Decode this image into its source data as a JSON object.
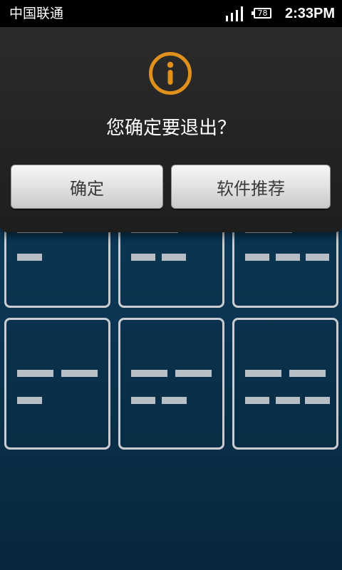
{
  "status_bar": {
    "carrier": "中国联通",
    "battery_level": "78",
    "time": "2:33PM",
    "icons": [
      "signal-icon",
      "battery-icon"
    ]
  },
  "dialog": {
    "icon": "info-icon",
    "accent_color": "#e0901c",
    "message": "您确定要退出？",
    "buttons": {
      "confirm_label": "确定",
      "recommend_label": "软件推荐"
    }
  }
}
